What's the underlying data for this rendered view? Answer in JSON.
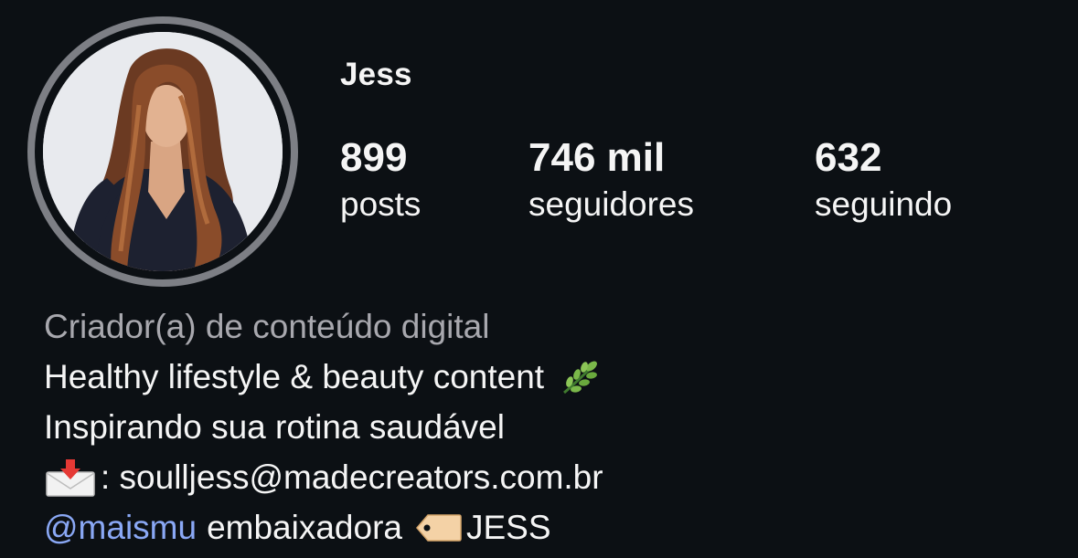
{
  "profile": {
    "username": "Jess",
    "avatar_icon": "profile-photo",
    "stats": {
      "posts_count": "899",
      "posts_label": "posts",
      "followers_count": "746 mil",
      "followers_label": "seguidores",
      "following_count": "632",
      "following_label": "seguindo"
    },
    "bio": {
      "category": "Criador(a) de conteúdo digital",
      "line1": "Healthy lifestyle & beauty content",
      "line1_emoji": "herb-icon",
      "line2": "Inspirando sua rotina saudável",
      "line3_emoji": "envelope-arrow-icon",
      "line3": ": soulljess@madecreators.com.br",
      "line4_mention": "@maismu",
      "line4_text": "embaixadora",
      "line4_emoji": "label-tag-icon",
      "line4_code": "JESS"
    }
  },
  "colors": {
    "background": "#0c1014",
    "text": "#f5f5f5",
    "muted": "#a8a8ae",
    "link": "#8aa8f5",
    "ring": "#7d7f85"
  }
}
